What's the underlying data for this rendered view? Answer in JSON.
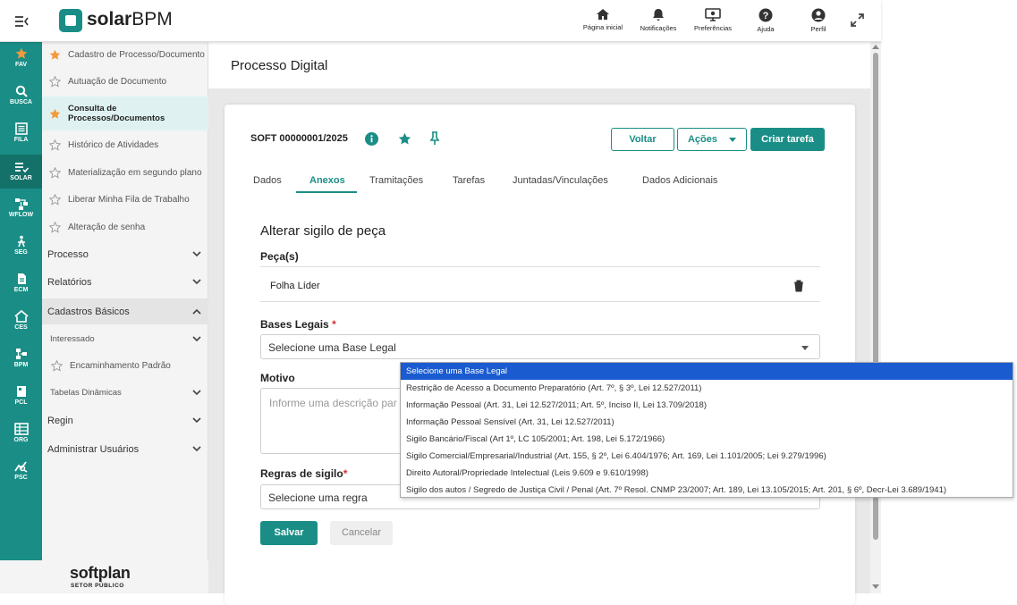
{
  "header": {
    "brand": "solar",
    "brand_bold": "BPM",
    "icons": [
      {
        "name": "home-icon",
        "label": "Página inicial"
      },
      {
        "name": "bell-icon",
        "label": "Notificações"
      },
      {
        "name": "preferences-icon",
        "label": "Preferências"
      },
      {
        "name": "help-icon",
        "label": "Ajuda"
      },
      {
        "name": "user-icon",
        "label": "Perfil"
      }
    ]
  },
  "rail": [
    {
      "label": "FAV",
      "icon": "star-icon"
    },
    {
      "label": "BUSCA",
      "icon": "search-icon"
    },
    {
      "label": "FILA",
      "icon": "list-icon"
    },
    {
      "label": "SOLAR",
      "icon": "solar-icon"
    },
    {
      "label": "WFLOW",
      "icon": "workflow-icon"
    },
    {
      "label": "SEG",
      "icon": "security-icon"
    },
    {
      "label": "ECM",
      "icon": "document-icon"
    },
    {
      "label": "CES",
      "icon": "ces-icon"
    },
    {
      "label": "BPM",
      "icon": "bpm-icon"
    },
    {
      "label": "PCL",
      "icon": "pcl-icon"
    },
    {
      "label": "ORG",
      "icon": "org-icon"
    },
    {
      "label": "PSC",
      "icon": "psc-icon"
    }
  ],
  "sidebar": {
    "links": [
      {
        "label": "Cadastro de Processo/Documento",
        "fav": true
      },
      {
        "label": "Autuação de Documento",
        "fav": false
      },
      {
        "label": "Consulta de Processos/Documentos",
        "fav": true
      },
      {
        "label": "Histórico de Atividades",
        "fav": false
      },
      {
        "label": "Materialização em segundo plano",
        "fav": false
      },
      {
        "label": "Liberar Minha Fila de Trabalho",
        "fav": false
      },
      {
        "label": "Alteração de senha",
        "fav": false
      }
    ],
    "sections": {
      "processo": "Processo",
      "relatorios": "Relatórios",
      "cadastros": "Cadastros Básicos",
      "interessado": "Interessado",
      "encaminhamento": "Encaminhamento Padrão",
      "tabelas": "Tabelas Dinâmicas",
      "regin": "Regin",
      "admin": "Administrar Usuários"
    },
    "footer_brand": "softplan",
    "footer_sub": "SETOR PÚBLICO"
  },
  "page": {
    "title": "Processo Digital",
    "process_number": "SOFT 00000001/2025",
    "buttons": {
      "voltar": "Voltar",
      "acoes": "Ações",
      "criar": "Criar tarefa"
    },
    "tabs": [
      "Dados",
      "Anexos",
      "Tramitações",
      "Tarefas",
      "Juntadas/Vinculações",
      "Dados Adicionais"
    ],
    "active_tab": "Anexos"
  },
  "form": {
    "section_title": "Alterar sigilo de peça",
    "pecas_label": "Peça(s)",
    "peca_item": "Folha Líder",
    "bases_label": "Bases Legais",
    "bases_value": "Selecione uma Base Legal",
    "motivo_label": "Motivo",
    "motivo_placeholder": "Informe uma descrição par",
    "regras_label": "Regras de sigilo",
    "regras_value": "Selecione uma regra",
    "required_mark": "*",
    "save": "Salvar",
    "cancel": "Cancelar"
  },
  "dropdown": {
    "options": [
      "Selecione uma Base Legal",
      "Restrição de Acesso a Documento Preparatório (Art. 7º, § 3º, Lei 12.527/2011)",
      "Informação Pessoal (Art. 31, Lei 12.527/2011; Art. 5º, Inciso II, Lei 13.709/2018)",
      "Informação Pessoal Sensível (Art. 31, Lei 12.527/2011)",
      "Sigilo Bancário/Fiscal (Art 1º, LC 105/2001; Art. 198, Lei 5.172/1966)",
      "Sigilo Comercial/Empresarial/Industrial (Art. 155, § 2º, Lei 6.404/1976; Art. 169, Lei 1.101/2005; Lei 9.279/1996)",
      "Direito Autoral/Propriedade Intelectual (Leis 9.609 e 9.610/1998)",
      "Sigilo dos autos / Segredo de Justiça Civil / Penal (Art. 7º Resol. CNMP 23/2007; Art. 189, Lei 13.105/2015; Art. 201, § 6º, Decr-Lei 3.689/1941)"
    ],
    "selected_index": 0
  },
  "colors": {
    "brand": "#1a8e86",
    "selected_option": "#1a5bd0",
    "required": "#d42f2f"
  }
}
